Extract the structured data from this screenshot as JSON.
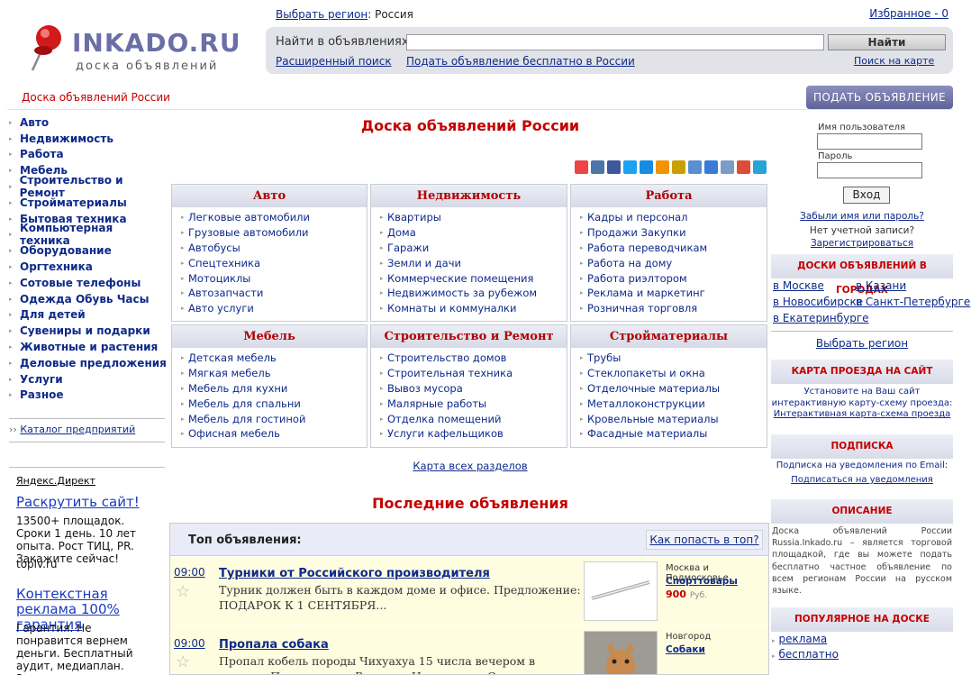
{
  "header": {
    "logo_text": "INKADO.RU",
    "logo_sub": "доска объявлений",
    "region_link": "Выбрать регион",
    "region_value": ": Россия",
    "favorites": "Избранное - 0",
    "search_label": "Найти в объявлениях:",
    "search_value": "",
    "search_button": "Найти",
    "advanced_search": "Расширенный поиск",
    "post_free": "Подать объявление бесплатно в России",
    "map_search": "Поиск на карте"
  },
  "bar": {
    "title": "Доска объявлений России",
    "post_ad_button": "ПОДАТЬ ОБЪЯВЛЕНИЕ"
  },
  "left_nav": {
    "items": [
      "Авто",
      "Недвижимость",
      "Работа",
      "Мебель",
      "Строительство и Ремонт",
      "Стройматериалы",
      "Бытовая техника",
      "Компьютерная техника",
      "Оборудование",
      "Оргтехника",
      "Сотовые телефоны",
      "Одежда Обувь Часы",
      "Для детей",
      "Сувениры и подарки",
      "Животные и растения",
      "Деловые предложения",
      "Услуги",
      "Разное"
    ],
    "catalog_prefix": "››",
    "catalog": "Каталог предприятий"
  },
  "yandex": {
    "title": "Яндекс.Директ",
    "ads": [
      {
        "link": "Раскрутить сайт!",
        "text": "13500+ площадок. Сроки 1 день. 10 лет опыта. Рост ТИЦ, PR. Закажите сейчас!",
        "url": "toplv.ru"
      },
      {
        "link": "Контекстная реклама 100% гарантия",
        "text": "Гарантия. Не понравится вернем деньги. Бесплатный аудит, медиаплан. Звоните",
        "url": ""
      }
    ]
  },
  "main": {
    "title": "Доска объявлений России",
    "categories": [
      {
        "name": "Авто",
        "items": [
          "Легковые автомобили",
          "Грузовые автомобили",
          "Автобусы",
          "Спецтехника",
          "Мотоциклы",
          "Автозапчасти",
          "Авто услуги"
        ]
      },
      {
        "name": "Недвижимость",
        "items": [
          "Квартиры",
          "Дома",
          "Гаражи",
          "Земли и дачи",
          "Коммерческие помещения",
          "Недвижимость за рубежом",
          "Комнаты и коммуналки"
        ]
      },
      {
        "name": "Работа",
        "items": [
          "Кадры и персонал",
          "Продажи Закупки",
          "Работа переводчикам",
          "Работа на дому",
          "Работа риэлтором",
          "Реклама и маркетинг",
          "Розничная торговля"
        ]
      },
      {
        "name": "Мебель",
        "items": [
          "Детская мебель",
          "Мягкая мебель",
          "Мебель для кухни",
          "Мебель для спальни",
          "Мебель для гостиной",
          "Офисная мебель"
        ]
      },
      {
        "name": "Строительство и Ремонт",
        "items": [
          "Строительство домов",
          "Строительная техника",
          "Вывоз мусора",
          "Малярные работы",
          "Отделка помещений",
          "Услуги кафельщиков"
        ]
      },
      {
        "name": "Стройматериалы",
        "items": [
          "Трубы",
          "Стеклопакеты и окна",
          "Отделочные материалы",
          "Металлоконструкции",
          "Кровельные материалы",
          "Фасадные материалы"
        ]
      }
    ],
    "all_sections": "Карта всех разделов",
    "latest_title": "Последние объявления",
    "top_label": "Топ объявления:",
    "top_how": "Как попасть в топ?",
    "ads": [
      {
        "time": "09:00",
        "title": "Турники от Российского производителя",
        "desc": "Турник должен быть в каждом доме и офисе. Предложение: ПОДАРОК К 1 СЕНТЯБРЯ...",
        "location": "Москва и Подмосковье",
        "category": "Спорттовары",
        "price": "900",
        "currency": "Руб."
      },
      {
        "time": "09:00",
        "title": "Пропала собака",
        "desc": "Пропал кобель породы Чихуахуа 15 числа вечером в деревне Подгорье под Великим Новгородом Свет...",
        "location": "Новгород",
        "category": "Собаки",
        "price": "",
        "currency": ""
      }
    ]
  },
  "right": {
    "username_label": "Имя пользователя",
    "password_label": "Пароль",
    "login_button": "Вход",
    "forgot": "Забыли имя или пароль?",
    "no_account": "Нет учетной записи?",
    "register": "Зарегистрироваться",
    "cities_head": "ДОСКИ ОБЪЯВЛЕНИЙ В ГОРОДАХ",
    "cities": [
      "в Москве",
      "в Казани",
      "в Новосибирске",
      "в Санкт-Петербурге",
      "в Екатеринбурге"
    ],
    "choose_region": "Выбрать регион",
    "map_head": "КАРТА ПРОЕЗДА НА САЙТ",
    "map_text": "Установите на Ваш сайт интерактивную карту-схему проезда:",
    "map_link": "Интерактивная карта-схема проезда",
    "sub_head": "ПОДПИСКА",
    "sub_text": "Подписка на уведомления по Email:",
    "sub_link": "Подписаться на уведомления",
    "desc_head": "ОПИСАНИЕ",
    "desc_text": "Доска объявлений России Russia.Inkado.ru – является торговой площадкой, где вы можете подать бесплатно частное объявление по всем регионам России на русском языке.",
    "popular_head": "ПОПУЛЯРНОЕ НА ДОСКЕ",
    "popular": [
      "реклама",
      "бесплатно"
    ]
  },
  "colors": {
    "accent_red": "#c40000",
    "link": "#0e2a8a",
    "button_purple": "#6e72a8"
  }
}
